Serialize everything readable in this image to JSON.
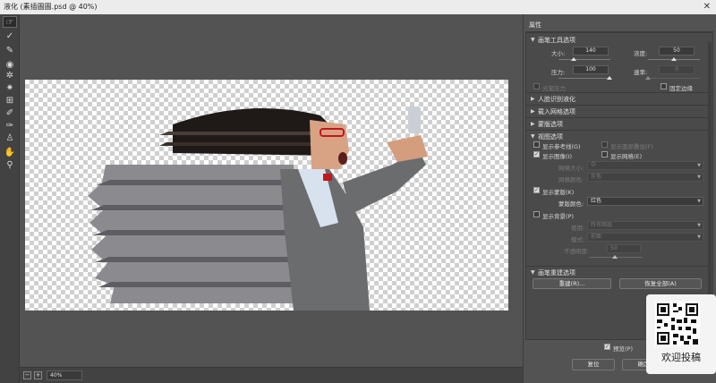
{
  "window": {
    "title": "液化 (素插圖圖.psd @ 40%)",
    "close": "✕"
  },
  "toolbar": {
    "tools": [
      {
        "name": "forward-warp-tool-icon",
        "glyph": "☞"
      },
      {
        "name": "reconstruct-tool-icon",
        "glyph": "✓"
      },
      {
        "name": "smooth-tool-icon",
        "glyph": "✎"
      },
      {
        "name": "twirl-clockwise-tool-icon",
        "glyph": "◉"
      },
      {
        "name": "pucker-tool-icon",
        "glyph": "✲"
      },
      {
        "name": "bloat-tool-icon",
        "glyph": "✷"
      },
      {
        "name": "push-left-tool-icon",
        "glyph": "⊞"
      },
      {
        "name": "freeze-mask-tool-icon",
        "glyph": "✐"
      },
      {
        "name": "thaw-mask-tool-icon",
        "glyph": "✑"
      },
      {
        "name": "face-tool-icon",
        "glyph": "♙"
      },
      {
        "name": "hand-tool-icon",
        "glyph": "✋"
      },
      {
        "name": "zoom-tool-icon",
        "glyph": "⚲"
      }
    ]
  },
  "status": {
    "zoom": "40%",
    "minus": "−",
    "plus": "+"
  },
  "panel": {
    "title": "属性",
    "brush": {
      "heading": "画笔工具选项",
      "size_label": "大小:",
      "size": "140",
      "density_label": "浓度:",
      "density": "50",
      "pressure_label": "压力:",
      "pressure": "100",
      "rate_label": "速率:",
      "rate": "0",
      "stylus_label": "光笔压力",
      "pin_edges_label": "固定边缘"
    },
    "collapsed_sections": [
      "人脸识别液化",
      "载入网格选项",
      "蒙版选项"
    ],
    "view": {
      "heading": "视图选项",
      "show_guides": "显示参考线(G)",
      "show_face_overlay": "显示面部叠加(F)",
      "show_image": "显示图像(I)",
      "show_mesh": "显示网格(E)",
      "mesh_size_label": "网格大小:",
      "mesh_size": "中",
      "mesh_color_label": "网格颜色:",
      "mesh_color": "灰色",
      "show_mask": "显示蒙版(K)",
      "mask_color_label": "蒙版颜色:",
      "mask_color": "红色",
      "show_backdrop": "显示背景(P)",
      "use_label": "使用:",
      "use": "所有图层",
      "mode_label": "模式:",
      "mode": "前面",
      "opacity_label": "不透明度:",
      "opacity": "50"
    },
    "reconstruct": {
      "heading": "画笔重建选项",
      "reconstruct_btn": "重建(R)...",
      "restore_all_btn": "恢复全部(A)"
    },
    "preview_label": "预览(P)",
    "cancel_btn": "复位",
    "ok_btn": "确定"
  },
  "qr": {
    "label": "欢迎投稿"
  }
}
